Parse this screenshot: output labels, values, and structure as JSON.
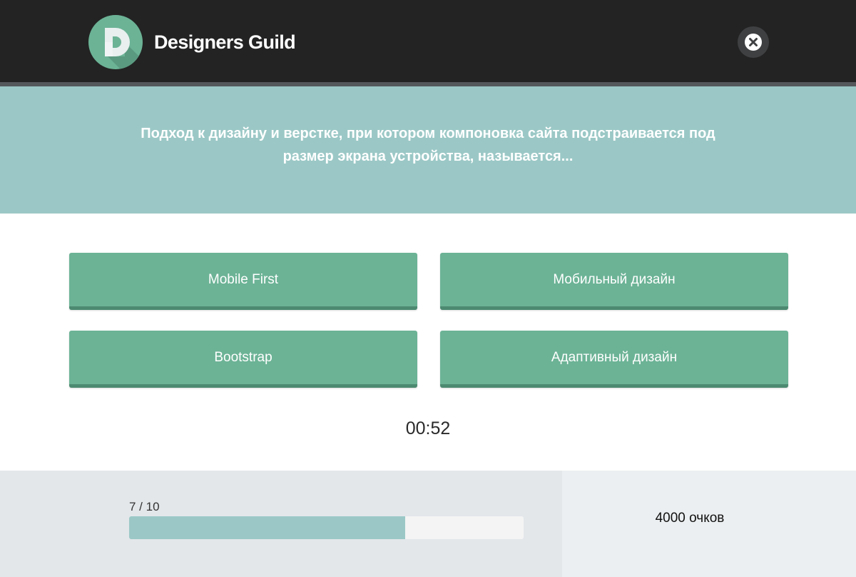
{
  "header": {
    "brand": "Designers Guild",
    "logo_letter": "D",
    "close_icon": "close-icon"
  },
  "question": {
    "text": "Подход к дизайну и верстке, при котором компоновка сайта подстраивается под размер экрана устройства, называется..."
  },
  "answers": [
    {
      "label": "Mobile First"
    },
    {
      "label": "Мобильный дизайн"
    },
    {
      "label": "Bootstrap"
    },
    {
      "label": "Адаптивный дизайн"
    }
  ],
  "timer": "00:52",
  "progress": {
    "label": "7 / 10",
    "current": 7,
    "total": 10
  },
  "score": "4000 очков",
  "colors": {
    "header_bg": "#232323",
    "accent": "#9bc8c6",
    "button": "#6cb396",
    "button_shadow": "#4c8a71",
    "footer": "#e3e7ea"
  }
}
